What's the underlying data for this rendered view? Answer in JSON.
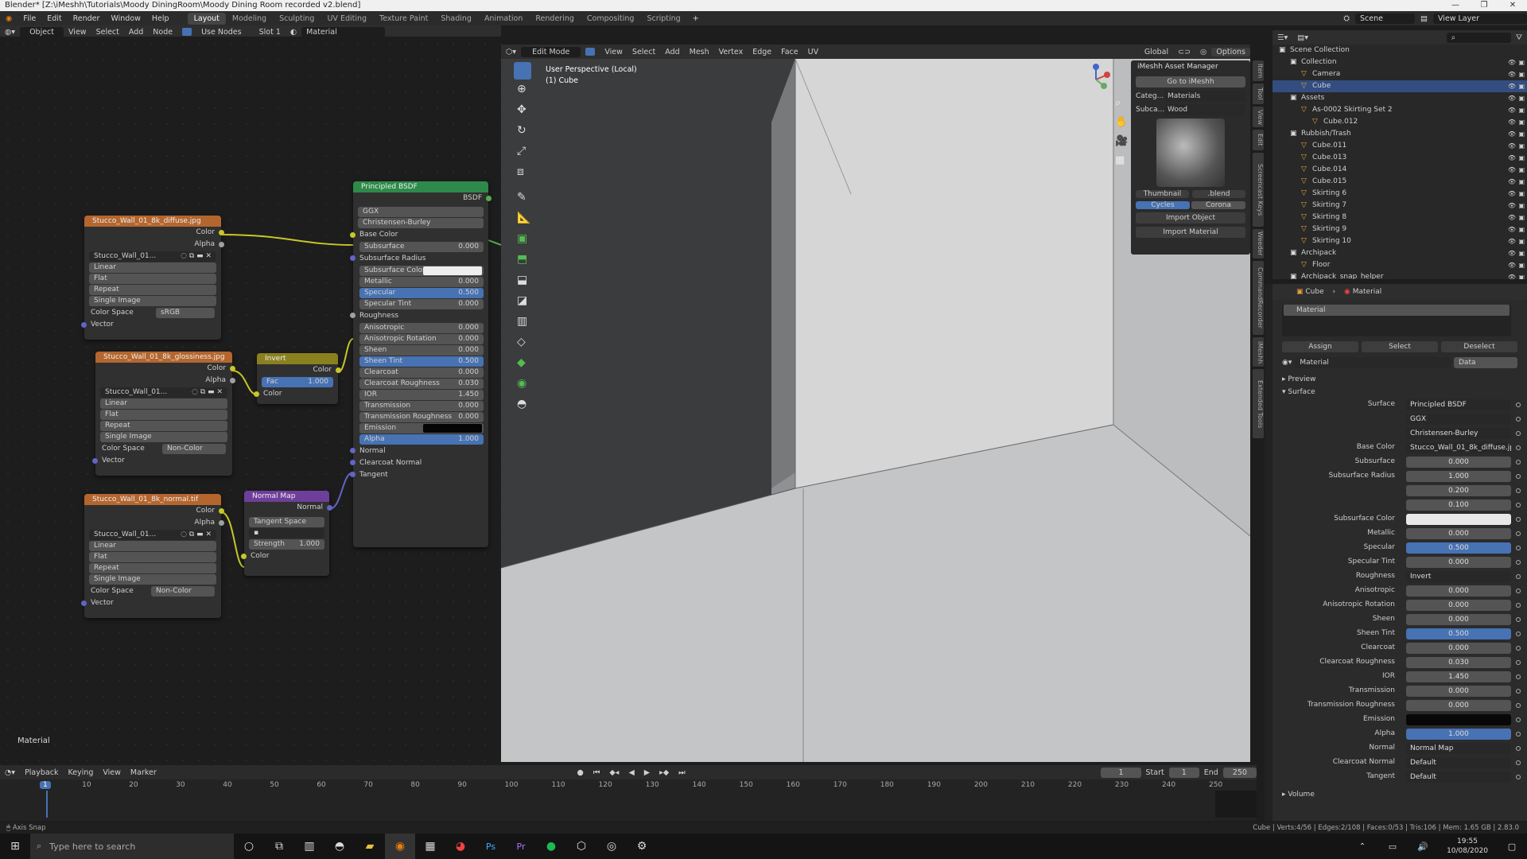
{
  "window": {
    "title": "Blender* [Z:\\iMeshh\\Tutorials\\Moody DiningRoom\\Moody Dining Room recorded v2.blend]",
    "controls": [
      "—",
      "❐",
      "✕"
    ]
  },
  "menubar": {
    "menus": [
      "File",
      "Edit",
      "Render",
      "Window",
      "Help"
    ],
    "workspaces": [
      "Layout",
      "Modeling",
      "Sculpting",
      "UV Editing",
      "Texture Paint",
      "Shading",
      "Animation",
      "Rendering",
      "Compositing",
      "Scripting"
    ],
    "active_workspace": "Layout",
    "scene": "Scene",
    "view_layer": "View Layer"
  },
  "node_editor": {
    "header": {
      "mode": "Object",
      "menus": [
        "View",
        "Select",
        "Add",
        "Node"
      ],
      "use_nodes": "Use Nodes",
      "slot": "Slot 1",
      "material": "Material"
    },
    "footer_label": "Material",
    "tex1": {
      "title": "Stucco_Wall_01_8k_diffuse.jpg",
      "out1": "Color",
      "out2": "Alpha",
      "image": "Stucco_Wall_01...",
      "interp": "Linear",
      "proj": "Flat",
      "ext": "Repeat",
      "src": "Single Image",
      "cs_label": "Color Space",
      "cs": "sRGB",
      "vec": "Vector"
    },
    "tex2": {
      "title": "Stucco_Wall_01_8k_glossiness.jpg",
      "out1": "Color",
      "out2": "Alpha",
      "image": "Stucco_Wall_01...",
      "interp": "Linear",
      "proj": "Flat",
      "ext": "Repeat",
      "src": "Single Image",
      "cs_label": "Color Space",
      "cs": "Non-Color",
      "vec": "Vector"
    },
    "tex3": {
      "title": "Stucco_Wall_01_8k_normal.tif",
      "out1": "Color",
      "out2": "Alpha",
      "image": "Stucco_Wall_01...",
      "interp": "Linear",
      "proj": "Flat",
      "ext": "Repeat",
      "src": "Single Image",
      "cs_label": "Color Space",
      "cs": "Non-Color",
      "vec": "Vector"
    },
    "invert": {
      "title": "Invert",
      "out": "Color",
      "fac_label": "Fac",
      "fac": "1.000",
      "in": "Color"
    },
    "normalmap": {
      "title": "Normal Map",
      "out": "Normal",
      "space": "Tangent Space",
      "strength_label": "Strength",
      "strength": "1.000",
      "in": "Color"
    },
    "bsdf": {
      "title": "Principled BSDF",
      "out": "BSDF",
      "dist": "GGX",
      "sss": "Christensen-Burley",
      "base": "Base Color",
      "rows": [
        {
          "label": "Subsurface",
          "value": "0.000"
        },
        {
          "label": "Subsurface Radius",
          "value": ""
        },
        {
          "label": "Subsurface Color",
          "value": ""
        },
        {
          "label": "Metallic",
          "value": "0.000"
        },
        {
          "label": "Specular",
          "value": "0.500"
        },
        {
          "label": "Specular Tint",
          "value": "0.000"
        },
        {
          "label": "Roughness",
          "value": ""
        },
        {
          "label": "Anisotropic",
          "value": "0.000"
        },
        {
          "label": "Anisotropic Rotation",
          "value": "0.000"
        },
        {
          "label": "Sheen",
          "value": "0.000"
        },
        {
          "label": "Sheen Tint",
          "value": "0.500"
        },
        {
          "label": "Clearcoat",
          "value": "0.000"
        },
        {
          "label": "Clearcoat Roughness",
          "value": "0.030"
        },
        {
          "label": "IOR",
          "value": "1.450"
        },
        {
          "label": "Transmission",
          "value": "0.000"
        },
        {
          "label": "Transmission Roughness",
          "value": "0.000"
        },
        {
          "label": "Emission",
          "value": ""
        },
        {
          "label": "Alpha",
          "value": "1.000"
        },
        {
          "label": "Normal",
          "value": ""
        },
        {
          "label": "Clearcoat Normal",
          "value": ""
        },
        {
          "label": "Tangent",
          "value": ""
        }
      ]
    }
  },
  "viewport": {
    "mode": "Edit Mode",
    "menus": [
      "View",
      "Select",
      "Add",
      "Mesh",
      "Vertex",
      "Edge",
      "Face",
      "UV"
    ],
    "orientation": "Global",
    "options": "Options",
    "overlay_line1": "User Perspective (Local)",
    "overlay_line2": "(1) Cube"
  },
  "asset_manager": {
    "title": "iMeshh Asset Manager",
    "goto": "Go to iMeshh",
    "cat_label": "Categ...",
    "cat": "Materials",
    "sub_label": "Subca...",
    "sub": "Wood",
    "thumb_label": "Thumbnail",
    "blend": ".blend",
    "engine1": "Cycles",
    "engine2": "Corona",
    "import_obj": "Import Object",
    "import_mat": "Import Material"
  },
  "side_tabs": [
    "Item",
    "Tool",
    "View",
    "Edit",
    "Screencast Keys",
    "Weeder",
    "CommandRecorder",
    "iMeshh",
    "Extended Tools"
  ],
  "outliner": {
    "rows": [
      {
        "label": "Scene Collection",
        "indent": 0,
        "sel": false
      },
      {
        "label": "Collection",
        "indent": 1,
        "sel": false
      },
      {
        "label": "Camera",
        "indent": 2,
        "sel": false
      },
      {
        "label": "Cube",
        "indent": 2,
        "sel": true
      },
      {
        "label": "Assets",
        "indent": 1,
        "sel": false
      },
      {
        "label": "As-0002 Skirting Set 2",
        "indent": 2,
        "sel": false
      },
      {
        "label": "Cube.012",
        "indent": 3,
        "sel": false
      },
      {
        "label": "Rubbish/Trash",
        "indent": 1,
        "sel": false
      },
      {
        "label": "Cube.011",
        "indent": 2,
        "sel": false
      },
      {
        "label": "Cube.013",
        "indent": 2,
        "sel": false
      },
      {
        "label": "Cube.014",
        "indent": 2,
        "sel": false
      },
      {
        "label": "Cube.015",
        "indent": 2,
        "sel": false
      },
      {
        "label": "Skirting 6",
        "indent": 2,
        "sel": false
      },
      {
        "label": "Skirting 7",
        "indent": 2,
        "sel": false
      },
      {
        "label": "Skirting 8",
        "indent": 2,
        "sel": false
      },
      {
        "label": "Skirting 9",
        "indent": 2,
        "sel": false
      },
      {
        "label": "Skirting 10",
        "indent": 2,
        "sel": false
      },
      {
        "label": "Archipack",
        "indent": 1,
        "sel": false
      },
      {
        "label": "Floor",
        "indent": 2,
        "sel": false
      },
      {
        "label": "Archipack_snap_helper",
        "indent": 1,
        "sel": false
      }
    ]
  },
  "properties": {
    "crumb_obj": "Cube",
    "crumb_mat": "Material",
    "slot": "Material",
    "assign": "Assign",
    "select": "Select",
    "deselect": "Deselect",
    "mat_name": "Material",
    "data": "Data",
    "preview": "Preview",
    "surface": "Surface",
    "volume": "Volume",
    "rows": [
      {
        "label": "Surface",
        "value": "Principled BSDF",
        "style": "plain"
      },
      {
        "label": "",
        "value": "GGX",
        "style": "plain"
      },
      {
        "label": "",
        "value": "Christensen-Burley",
        "style": "plain"
      },
      {
        "label": "Base Color",
        "value": "Stucco_Wall_01_8k_diffuse.jpg",
        "style": "plain"
      },
      {
        "label": "Subsurface",
        "value": "0.000",
        "style": "num"
      },
      {
        "label": "Subsurface Radius",
        "value": "1.000",
        "style": "num"
      },
      {
        "label": "",
        "value": "0.200",
        "style": "num"
      },
      {
        "label": "",
        "value": "0.100",
        "style": "num"
      },
      {
        "label": "Subsurface Color",
        "value": "",
        "style": "white"
      },
      {
        "label": "Metallic",
        "value": "0.000",
        "style": "num"
      },
      {
        "label": "Specular",
        "value": "0.500",
        "style": "blue"
      },
      {
        "label": "Specular Tint",
        "value": "0.000",
        "style": "num"
      },
      {
        "label": "Roughness",
        "value": "Invert",
        "style": "plain"
      },
      {
        "label": "Anisotropic",
        "value": "0.000",
        "style": "num"
      },
      {
        "label": "Anisotropic Rotation",
        "value": "0.000",
        "style": "num"
      },
      {
        "label": "Sheen",
        "value": "0.000",
        "style": "num"
      },
      {
        "label": "Sheen Tint",
        "value": "0.500",
        "style": "blue"
      },
      {
        "label": "Clearcoat",
        "value": "0.000",
        "style": "num"
      },
      {
        "label": "Clearcoat Roughness",
        "value": "0.030",
        "style": "num"
      },
      {
        "label": "IOR",
        "value": "1.450",
        "style": "num"
      },
      {
        "label": "Transmission",
        "value": "0.000",
        "style": "num"
      },
      {
        "label": "Transmission Roughness",
        "value": "0.000",
        "style": "num"
      },
      {
        "label": "Emission",
        "value": "",
        "style": "black"
      },
      {
        "label": "Alpha",
        "value": "1.000",
        "style": "blue"
      },
      {
        "label": "Normal",
        "value": "Normal Map",
        "style": "plain"
      },
      {
        "label": "Clearcoat Normal",
        "value": "Default",
        "style": "plain"
      },
      {
        "label": "Tangent",
        "value": "Default",
        "style": "plain"
      }
    ]
  },
  "timeline": {
    "menus": [
      "Playback",
      "Keying",
      "View",
      "Marker"
    ],
    "current": "1",
    "start_label": "Start",
    "start": "1",
    "end_label": "End",
    "end": "250",
    "ticks": [
      "1",
      "10",
      "20",
      "30",
      "40",
      "50",
      "60",
      "70",
      "80",
      "90",
      "100",
      "110",
      "120",
      "130",
      "140",
      "150",
      "160",
      "170",
      "180",
      "190",
      "200",
      "210",
      "220",
      "230",
      "240",
      "250"
    ]
  },
  "statusbar": {
    "left": "Axis Snap",
    "right": "Cube | Verts:4/56 | Edges:2/108 | Faces:0/53 | Tris:106 | Mem: 1.65 GB | 2.83.0"
  },
  "taskbar": {
    "search": "Type here to search",
    "time": "19:55",
    "date": "10/08/2020"
  },
  "colors": {
    "accent": "#4772b3",
    "texnode": "#b4662e",
    "bsdf": "#2e8a4a",
    "invert": "#8a8020",
    "normalmap": "#6e3f9a",
    "socket_yellow": "#c7c729",
    "socket_purple": "#6363c7",
    "socket_green": "#50b050",
    "socket_gray": "#a0a0a0"
  }
}
